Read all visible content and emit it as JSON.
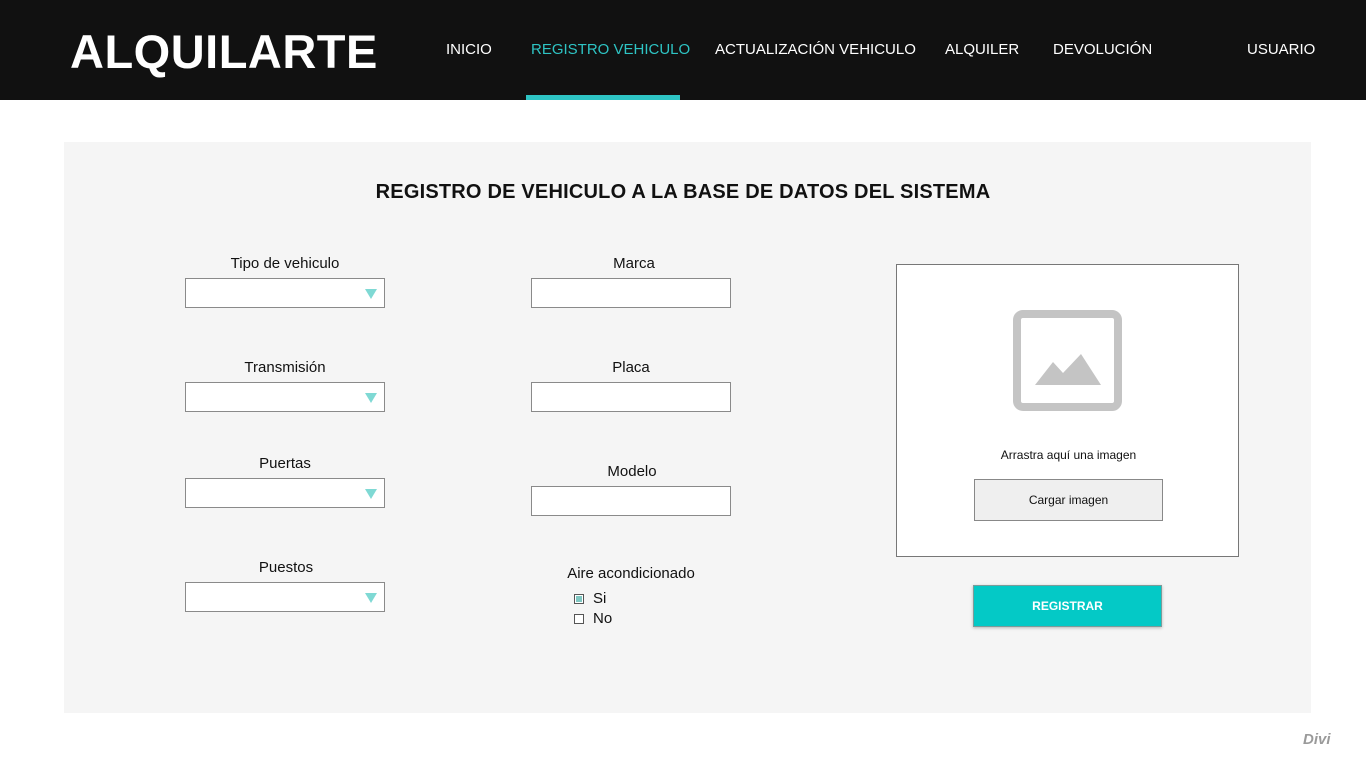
{
  "header": {
    "logo": "ALQUILARTE",
    "nav": [
      {
        "label": "INICIO",
        "active": false
      },
      {
        "label": "REGISTRO VEHICULO",
        "active": true
      },
      {
        "label": "ACTUALIZACIÓN VEHICULO",
        "active": false
      },
      {
        "label": "ALQUILER",
        "active": false
      },
      {
        "label": "DEVOLUCIÓN",
        "active": false
      }
    ],
    "user_label": "USUARIO",
    "accent_color": "#2ec4c4"
  },
  "main": {
    "title": "REGISTRO DE VEHICULO A LA BASE DE DATOS DEL SISTEMA",
    "selects": [
      {
        "label": "Tipo de vehiculo",
        "value": ""
      },
      {
        "label": "Transmisión",
        "value": ""
      },
      {
        "label": "Puertas",
        "value": ""
      },
      {
        "label": "Puestos",
        "value": ""
      }
    ],
    "inputs": [
      {
        "label": "Marca",
        "value": ""
      },
      {
        "label": "Placa",
        "value": ""
      },
      {
        "label": "Modelo",
        "value": ""
      }
    ],
    "air_conditioning": {
      "label": "Aire acondicionado",
      "options": [
        {
          "label": "Si",
          "checked": true
        },
        {
          "label": "No",
          "checked": false
        }
      ]
    },
    "image_upload": {
      "icon": "image-placeholder-icon",
      "drop_text": "Arrastra aquí una imagen",
      "button_label": "Cargar imagen"
    },
    "submit_label": "REGISTRAR",
    "submit_color": "#04c9c6"
  },
  "watermark": "Divi"
}
